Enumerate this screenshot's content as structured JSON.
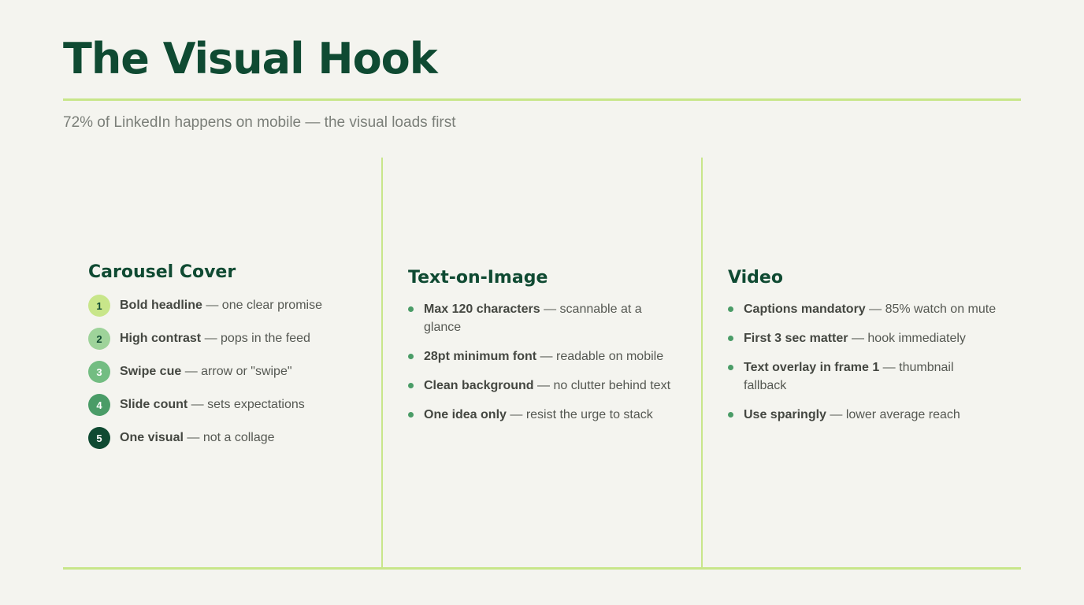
{
  "title": "The Visual Hook",
  "subtitle": "72% of LinkedIn happens on mobile — the visual loads first",
  "colors": {
    "background": "#f4f4ef",
    "heading": "#0f4a32",
    "accent_rule": "#c8e68a",
    "bullet": "#4a9c67"
  },
  "columns": [
    {
      "heading": "Carousel Cover",
      "style": "numbered",
      "items": [
        {
          "num": "1",
          "bold": "Bold headline",
          "rest": " — one clear promise"
        },
        {
          "num": "2",
          "bold": "High contrast",
          "rest": " — pops in the feed"
        },
        {
          "num": "3",
          "bold": "Swipe cue",
          "rest": " — arrow or \"swipe\""
        },
        {
          "num": "4",
          "bold": "Slide count",
          "rest": " — sets expectations"
        },
        {
          "num": "5",
          "bold": "One visual",
          "rest": " — not a collage"
        }
      ]
    },
    {
      "heading": "Text-on-Image",
      "style": "bullets",
      "items": [
        {
          "bold": "Max 120 characters",
          "rest": " — scannable at a glance"
        },
        {
          "bold": "28pt minimum font",
          "rest": " — readable on mobile"
        },
        {
          "bold": "Clean background",
          "rest": " — no clutter behind text"
        },
        {
          "bold": "One idea only",
          "rest": " — resist the urge to stack"
        }
      ]
    },
    {
      "heading": "Video",
      "style": "bullets",
      "items": [
        {
          "bold": "Captions mandatory",
          "rest": " — 85% watch on mute"
        },
        {
          "bold": "First 3 sec matter",
          "rest": " — hook immediately"
        },
        {
          "bold": "Text overlay in frame 1",
          "rest": " — thumbnail fallback"
        },
        {
          "bold": "Use sparingly",
          "rest": " — lower average reach"
        }
      ]
    }
  ]
}
